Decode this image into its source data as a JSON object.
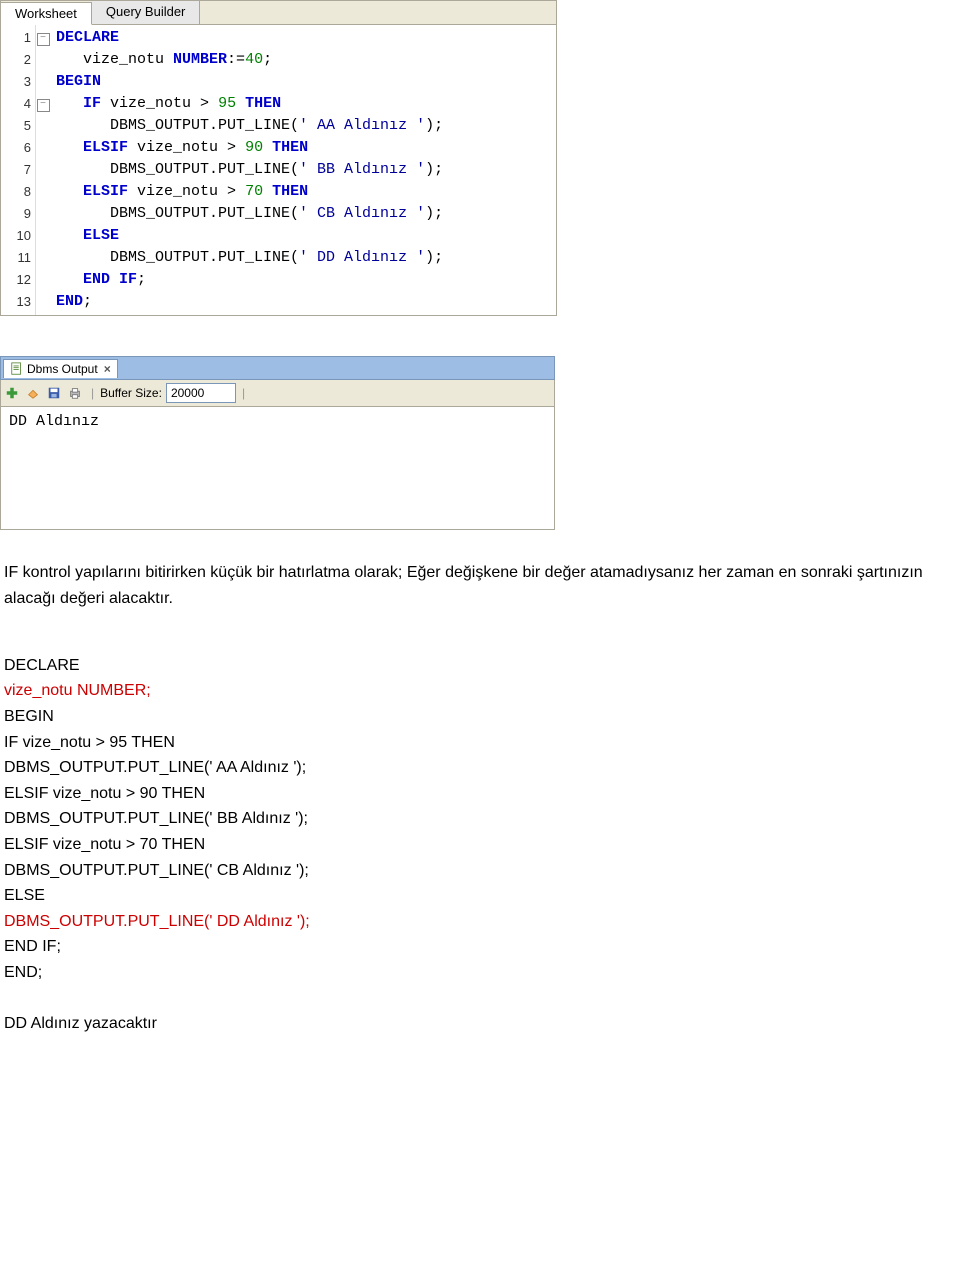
{
  "tabs": {
    "worksheet": "Worksheet",
    "query_builder": "Query Builder"
  },
  "code_lines": [
    {
      "n": 1,
      "fold": "-",
      "tokens": [
        [
          "kw",
          "DECLARE"
        ]
      ]
    },
    {
      "n": 2,
      "fold": "",
      "tokens": [
        [
          "ident",
          "   vize_notu "
        ],
        [
          "kw",
          "NUMBER"
        ],
        [
          "ident",
          ":="
        ],
        [
          "num",
          "40"
        ],
        [
          "ident",
          ";"
        ]
      ]
    },
    {
      "n": 3,
      "fold": "",
      "tokens": [
        [
          "kw",
          "BEGIN"
        ]
      ]
    },
    {
      "n": 4,
      "fold": "-",
      "tokens": [
        [
          "ident",
          "   "
        ],
        [
          "kw",
          "IF"
        ],
        [
          "ident",
          " vize_notu > "
        ],
        [
          "num",
          "95"
        ],
        [
          "ident",
          " "
        ],
        [
          "kw",
          "THEN"
        ]
      ]
    },
    {
      "n": 5,
      "fold": "",
      "tokens": [
        [
          "ident",
          "      DBMS_OUTPUT.PUT_LINE("
        ],
        [
          "str",
          "' AA Aldınız '"
        ],
        [
          "ident",
          ");"
        ]
      ]
    },
    {
      "n": 6,
      "fold": "",
      "tokens": [
        [
          "ident",
          "   "
        ],
        [
          "kw",
          "ELSIF"
        ],
        [
          "ident",
          " vize_notu > "
        ],
        [
          "num",
          "90"
        ],
        [
          "ident",
          " "
        ],
        [
          "kw",
          "THEN"
        ]
      ]
    },
    {
      "n": 7,
      "fold": "",
      "tokens": [
        [
          "ident",
          "      DBMS_OUTPUT.PUT_LINE("
        ],
        [
          "str",
          "' BB Aldınız '"
        ],
        [
          "ident",
          ");"
        ]
      ]
    },
    {
      "n": 8,
      "fold": "",
      "tokens": [
        [
          "ident",
          "   "
        ],
        [
          "kw",
          "ELSIF"
        ],
        [
          "ident",
          " vize_notu > "
        ],
        [
          "num",
          "70"
        ],
        [
          "ident",
          " "
        ],
        [
          "kw",
          "THEN"
        ]
      ]
    },
    {
      "n": 9,
      "fold": "",
      "tokens": [
        [
          "ident",
          "      DBMS_OUTPUT.PUT_LINE("
        ],
        [
          "str",
          "' CB Aldınız '"
        ],
        [
          "ident",
          ");"
        ]
      ]
    },
    {
      "n": 10,
      "fold": "",
      "tokens": [
        [
          "ident",
          "   "
        ],
        [
          "kw",
          "ELSE"
        ]
      ]
    },
    {
      "n": 11,
      "fold": "",
      "tokens": [
        [
          "ident",
          "      DBMS_OUTPUT.PUT_LINE("
        ],
        [
          "str",
          "' DD Aldınız '"
        ],
        [
          "ident",
          ");"
        ]
      ]
    },
    {
      "n": 12,
      "fold": "",
      "tokens": [
        [
          "ident",
          "   "
        ],
        [
          "kw",
          "END IF"
        ],
        [
          "ident",
          ";"
        ]
      ]
    },
    {
      "n": 13,
      "fold": "",
      "tokens": [
        [
          "kw",
          "END"
        ],
        [
          "ident",
          ";"
        ]
      ]
    }
  ],
  "output": {
    "tab_label": "Dbms Output",
    "buffer_label": "Buffer Size:",
    "buffer_value": "20000",
    "text": " DD Aldınız"
  },
  "article": {
    "p1": "IF kontrol yapılarını bitirirken küçük bir hatırlatma olarak; Eğer değişkene bir değer atamadıysanız her zaman en sonraki şartınızın alacağı değeri alacaktır.",
    "c1": "DECLARE",
    "c2": "   vize_notu NUMBER;",
    "c3": "BEGIN",
    "c4": "   IF vize_notu > 95 THEN",
    "c5": "     DBMS_OUTPUT.PUT_LINE(' AA Aldınız ');",
    "c6": "   ELSIF vize_notu > 90 THEN",
    "c7": "     DBMS_OUTPUT.PUT_LINE(' BB Aldınız ');",
    "c8": "   ELSIF vize_notu > 70 THEN",
    "c9": "     DBMS_OUTPUT.PUT_LINE(' CB Aldınız ');",
    "c10": "   ELSE",
    "c11": "     DBMS_OUTPUT.PUT_LINE(' DD Aldınız ');",
    "c12": "   END IF;",
    "c13": "END;",
    "footer": "DD Aldınız yazacaktır"
  }
}
